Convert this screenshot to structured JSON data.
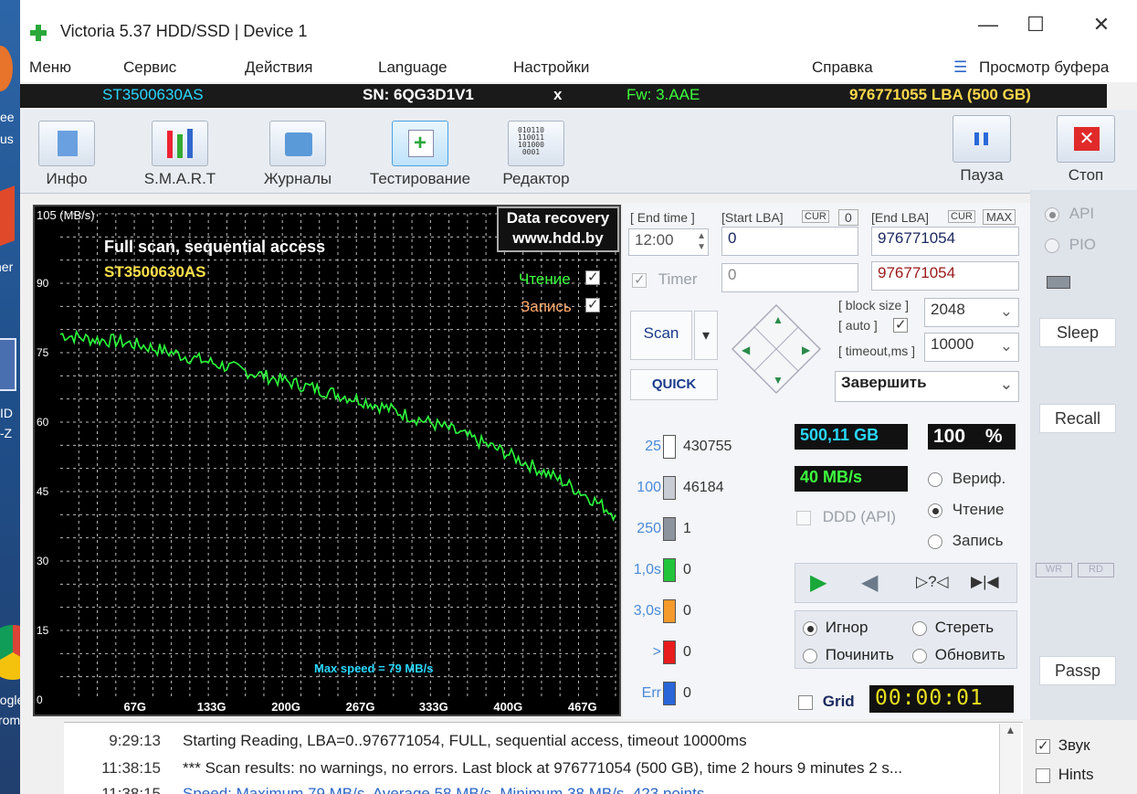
{
  "window": {
    "title": "Victoria 5.37 HDD/SSD | Device 1"
  },
  "desktop": {
    "labels": [
      "ee",
      "us",
      "ner",
      "ID",
      "I-Z",
      "oogle",
      "rome"
    ]
  },
  "menu": {
    "items": [
      "Меню",
      "Сервис",
      "Действия",
      "Language",
      "Настройки",
      "Справка"
    ],
    "buffer": "Просмотр буфера"
  },
  "device": {
    "model": "ST3500630AS",
    "serial": "SN: 6QG3D1V1",
    "close": "x",
    "firmware": "Fw: 3.AAE",
    "lba": "976771055 LBA (500 GB)"
  },
  "toolbar": {
    "info": "Инфо",
    "smart": "S.M.A.R.T",
    "logs": "Журналы",
    "testing": "Тестирование",
    "editor": "Редактор",
    "pause": "Пауза",
    "stop": "Стоп"
  },
  "graph": {
    "title": "Full scan, sequential access",
    "model": "ST3500630AS",
    "unit_label": "105 (MB/s)",
    "watermark1": "Data recovery",
    "watermark2": "www.hdd.by",
    "read_label": "Чтение",
    "write_label": "Запись",
    "max_speed": "Max speed = 79 MB/s",
    "y_ticks": [
      "90",
      "75",
      "60",
      "45",
      "30",
      "15",
      "0"
    ],
    "x_ticks": [
      "67G",
      "133G",
      "200G",
      "267G",
      "333G",
      "400G",
      "467G"
    ]
  },
  "chart_data": {
    "type": "line",
    "title": "Full scan, sequential access",
    "ylabel": "MB/s",
    "ylim": [
      0,
      105
    ],
    "xlim": [
      0,
      500
    ],
    "grid": true,
    "x": [
      0,
      25,
      50,
      75,
      100,
      125,
      150,
      175,
      200,
      225,
      250,
      275,
      300,
      325,
      350,
      375,
      400,
      425,
      450,
      475,
      500
    ],
    "y": [
      79,
      78,
      77.5,
      76.5,
      75,
      73.5,
      72,
      70.5,
      69,
      67.5,
      66,
      64.5,
      62.5,
      60.5,
      58.5,
      56,
      53.5,
      50.5,
      47.5,
      44,
      40
    ],
    "series": [
      {
        "name": "Чтение",
        "color": "#2cff3c"
      }
    ]
  },
  "scan": {
    "end_time_label": "[ End time ]",
    "start_lba_label": "[Start LBA]",
    "cur": "CUR",
    "cur_value": "0",
    "end_lba_label": "[End LBA]",
    "max": "MAX",
    "time_value": "12:00",
    "start_lba": "0",
    "end_lba": "976771054",
    "timer_label": "Timer",
    "timer_value": "0",
    "end_lba2": "976771054",
    "block_size_label": "[ block size ]",
    "auto_label": "[ auto ]",
    "block_size": "2048",
    "timeout_label": "[ timeout,ms ]",
    "timeout": "10000",
    "scan_button": "Scan",
    "quick_button": "QUICK",
    "finish": "Завершить"
  },
  "blocks": [
    {
      "label": "25",
      "count": "430755",
      "color": "#ffffff"
    },
    {
      "label": "100",
      "count": "46184",
      "color": "#c8ccd4"
    },
    {
      "label": "250",
      "count": "1",
      "color": "#8d939c"
    },
    {
      "label": "1,0s",
      "count": "0",
      "color": "#22c43a"
    },
    {
      "label": "3,0s",
      "count": "0",
      "color": "#f59a2c"
    },
    {
      "label": ">",
      "count": "0",
      "color": "#e81c1c"
    },
    {
      "label": "Err",
      "count": "0",
      "color": "#2a66d8"
    }
  ],
  "stats": {
    "size": "500,11 GB",
    "percent": "100",
    "percent_sign": "%",
    "speed": "40 MB/s",
    "ddd": "DDD (API)",
    "verify": "Вериф.",
    "read": "Чтение",
    "write": "Запись",
    "ignore": "Игнор",
    "erase": "Стереть",
    "repair": "Починить",
    "refresh": "Обновить",
    "grid": "Grid",
    "timer": "00:00:01"
  },
  "sidebar": {
    "api": "API",
    "pio": "PIO",
    "sleep": "Sleep",
    "recall": "Recall",
    "wr": "WR",
    "rd": "RD",
    "passp": "Passp",
    "sound": "Звук",
    "hints": "Hints"
  },
  "log": [
    {
      "time": "9:29:13",
      "text": "Starting Reading, LBA=0..976771054, FULL, sequential access, timeout 10000ms"
    },
    {
      "time": "11:38:15",
      "text": "*** Scan results: no warnings, no errors. Last block at 976771054 (500 GB), time 2 hours 9 minutes 2 s..."
    },
    {
      "time": "11:38:15",
      "text": "Speed: Maximum 79 MB/s. Average 58 MB/s. Minimum 38 MB/s. 423 points."
    }
  ]
}
